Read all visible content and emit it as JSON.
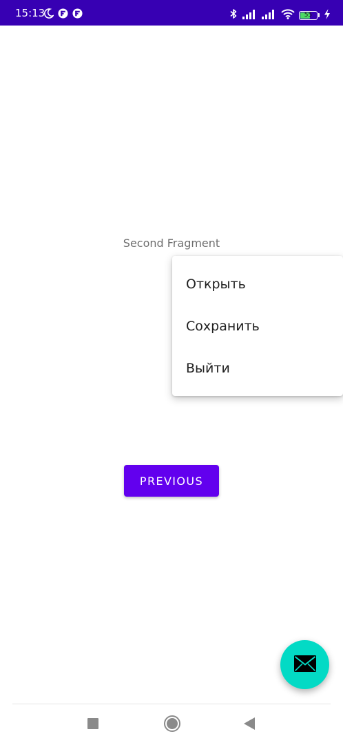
{
  "status_bar": {
    "time": "15:13",
    "battery_level": "55",
    "left_icons": [
      "moon-icon",
      "flipboard-icon",
      "flipboard-icon"
    ],
    "right_icons": [
      "bluetooth-icon",
      "signal-icon",
      "signal-icon",
      "wifi-icon",
      "battery-icon",
      "charging-icon"
    ],
    "background_color": "#3700b3"
  },
  "content": {
    "fragment_label": "Second Fragment"
  },
  "popup_menu": {
    "items": [
      {
        "label": "Открыть"
      },
      {
        "label": "Сохранить"
      },
      {
        "label": "Выйти"
      }
    ]
  },
  "previous_button": {
    "label": "PREVIOUS",
    "color": "#6200ee"
  },
  "fab": {
    "icon": "envelope-icon",
    "color": "#03dac5"
  },
  "nav_bar": {
    "buttons": [
      "recents-square-icon",
      "home-circle-icon",
      "back-triangle-icon"
    ]
  }
}
